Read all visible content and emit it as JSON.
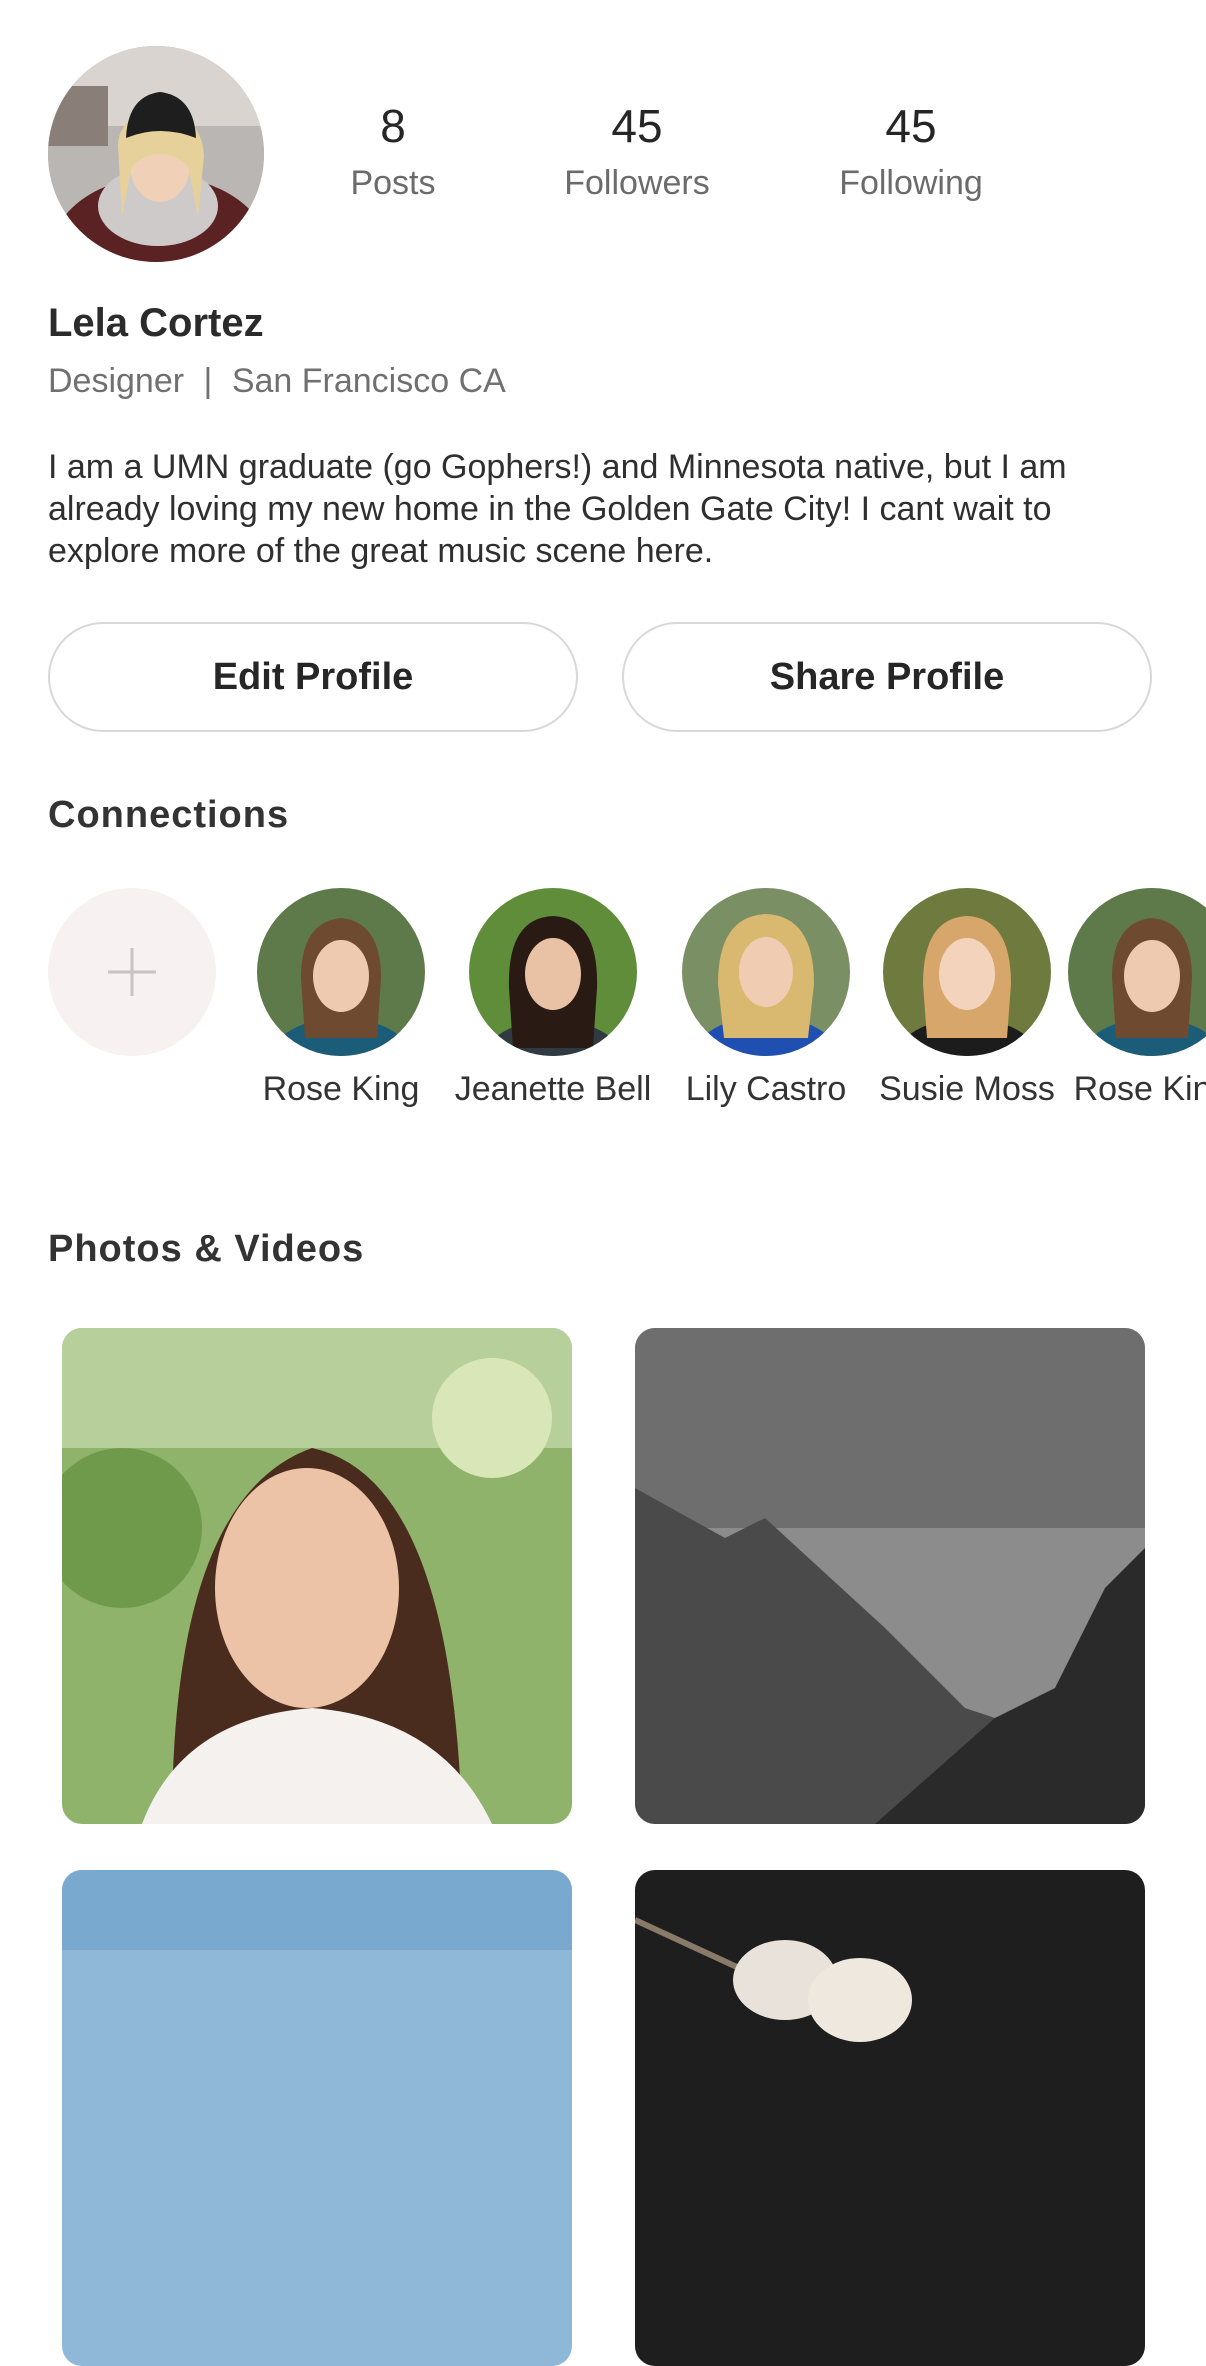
{
  "profile": {
    "name": "Lela Cortez",
    "role": "Designer",
    "separator": "|",
    "location": "San Francisco CA",
    "bio": "I am a UMN graduate (go Gophers!) and Minnesota native, but I am already loving my new home in the Golden Gate City! I cant wait to explore more of the great music scene here.",
    "avatar_icon": "user-avatar-photo"
  },
  "stats": {
    "posts": {
      "value": "8",
      "label": "Posts"
    },
    "followers": {
      "value": "45",
      "label": "Followers"
    },
    "following": {
      "value": "45",
      "label": "Following"
    }
  },
  "actions": {
    "edit_label": "Edit Profile",
    "share_label": "Share Profile"
  },
  "connections": {
    "title": "Connections",
    "add_icon": "plus-icon",
    "items": [
      {
        "name": "Rose King"
      },
      {
        "name": "Jeanette Bell"
      },
      {
        "name": "Lily Castro"
      },
      {
        "name": "Susie Moss"
      },
      {
        "name": "Rose King"
      }
    ]
  },
  "media": {
    "title": "Photos & Videos",
    "items": [
      {
        "kind": "photo-portrait-woman"
      },
      {
        "kind": "photo-misty-mountains"
      },
      {
        "kind": "photo-blue-sky"
      },
      {
        "kind": "photo-marshmallows"
      }
    ]
  },
  "colors": {
    "text_primary": "#262626",
    "text_secondary": "#6b6b6b",
    "button_border": "#d8d8d8",
    "add_circle_bg": "#f8f1f1"
  }
}
